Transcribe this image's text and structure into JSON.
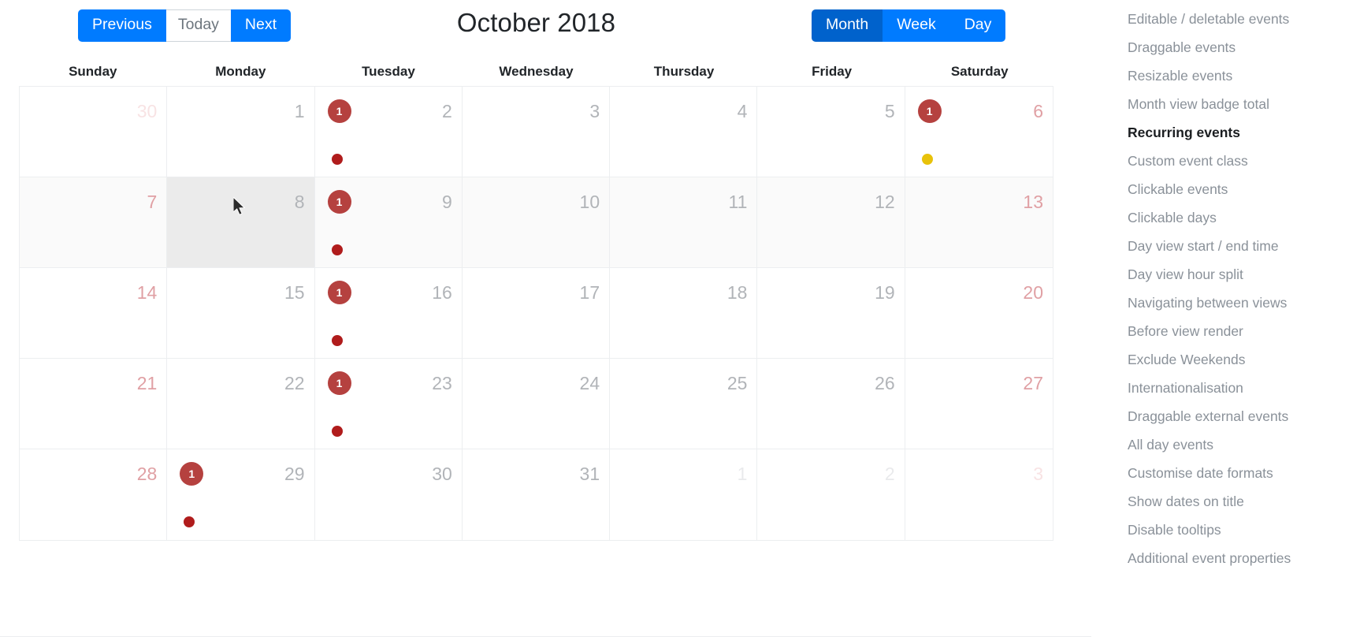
{
  "toolbar": {
    "previous_label": "Previous",
    "today_label": "Today",
    "next_label": "Next",
    "month_label": "Month",
    "week_label": "Week",
    "day_label": "Day",
    "active_view": "Month",
    "colors": {
      "primary": "#007bff",
      "primary_active": "#0062cc",
      "today_text": "#6c757d"
    }
  },
  "calendar": {
    "title": "October 2018",
    "weekdays": [
      "Sunday",
      "Monday",
      "Tuesday",
      "Wednesday",
      "Thursday",
      "Friday",
      "Saturday"
    ],
    "badge_color": "#b5413f",
    "dot_colors": {
      "red": "#b01c1c",
      "yellow": "#e8c20a"
    },
    "weeks": [
      {
        "alt": false,
        "days": [
          {
            "num": "30",
            "out": true,
            "weekend": true,
            "badge": null,
            "dot": null
          },
          {
            "num": "1",
            "out": false,
            "weekend": false,
            "badge": null,
            "dot": null
          },
          {
            "num": "2",
            "out": false,
            "weekend": false,
            "badge": "1",
            "dot": "red"
          },
          {
            "num": "3",
            "out": false,
            "weekend": false,
            "badge": null,
            "dot": null
          },
          {
            "num": "4",
            "out": false,
            "weekend": false,
            "badge": null,
            "dot": null
          },
          {
            "num": "5",
            "out": false,
            "weekend": false,
            "badge": null,
            "dot": null
          },
          {
            "num": "6",
            "out": false,
            "weekend": true,
            "badge": "1",
            "dot": "yellow"
          }
        ]
      },
      {
        "alt": true,
        "days": [
          {
            "num": "7",
            "out": false,
            "weekend": true,
            "badge": null,
            "dot": null
          },
          {
            "num": "8",
            "out": false,
            "weekend": false,
            "badge": null,
            "dot": null,
            "hovered": true
          },
          {
            "num": "9",
            "out": false,
            "weekend": false,
            "badge": "1",
            "dot": "red"
          },
          {
            "num": "10",
            "out": false,
            "weekend": false,
            "badge": null,
            "dot": null
          },
          {
            "num": "11",
            "out": false,
            "weekend": false,
            "badge": null,
            "dot": null
          },
          {
            "num": "12",
            "out": false,
            "weekend": false,
            "badge": null,
            "dot": null
          },
          {
            "num": "13",
            "out": false,
            "weekend": true,
            "badge": null,
            "dot": null
          }
        ]
      },
      {
        "alt": false,
        "days": [
          {
            "num": "14",
            "out": false,
            "weekend": true,
            "badge": null,
            "dot": null
          },
          {
            "num": "15",
            "out": false,
            "weekend": false,
            "badge": null,
            "dot": null
          },
          {
            "num": "16",
            "out": false,
            "weekend": false,
            "badge": "1",
            "dot": "red"
          },
          {
            "num": "17",
            "out": false,
            "weekend": false,
            "badge": null,
            "dot": null
          },
          {
            "num": "18",
            "out": false,
            "weekend": false,
            "badge": null,
            "dot": null
          },
          {
            "num": "19",
            "out": false,
            "weekend": false,
            "badge": null,
            "dot": null
          },
          {
            "num": "20",
            "out": false,
            "weekend": true,
            "badge": null,
            "dot": null
          }
        ]
      },
      {
        "alt": false,
        "days": [
          {
            "num": "21",
            "out": false,
            "weekend": true,
            "badge": null,
            "dot": null
          },
          {
            "num": "22",
            "out": false,
            "weekend": false,
            "badge": null,
            "dot": null
          },
          {
            "num": "23",
            "out": false,
            "weekend": false,
            "badge": "1",
            "dot": "red"
          },
          {
            "num": "24",
            "out": false,
            "weekend": false,
            "badge": null,
            "dot": null
          },
          {
            "num": "25",
            "out": false,
            "weekend": false,
            "badge": null,
            "dot": null
          },
          {
            "num": "26",
            "out": false,
            "weekend": false,
            "badge": null,
            "dot": null
          },
          {
            "num": "27",
            "out": false,
            "weekend": true,
            "badge": null,
            "dot": null
          }
        ]
      },
      {
        "alt": false,
        "days": [
          {
            "num": "28",
            "out": false,
            "weekend": true,
            "badge": null,
            "dot": null
          },
          {
            "num": "29",
            "out": false,
            "weekend": false,
            "badge": "1",
            "dot": "red"
          },
          {
            "num": "30",
            "out": false,
            "weekend": false,
            "badge": null,
            "dot": null
          },
          {
            "num": "31",
            "out": false,
            "weekend": false,
            "badge": null,
            "dot": null
          },
          {
            "num": "1",
            "out": true,
            "weekend": false,
            "badge": null,
            "dot": null
          },
          {
            "num": "2",
            "out": true,
            "weekend": false,
            "badge": null,
            "dot": null
          },
          {
            "num": "3",
            "out": true,
            "weekend": true,
            "badge": null,
            "dot": null
          }
        ]
      }
    ]
  },
  "sidebar": {
    "items": [
      {
        "label": "Editable / deletable events",
        "active": false
      },
      {
        "label": "Draggable events",
        "active": false
      },
      {
        "label": "Resizable events",
        "active": false
      },
      {
        "label": "Month view badge total",
        "active": false
      },
      {
        "label": "Recurring events",
        "active": true
      },
      {
        "label": "Custom event class",
        "active": false
      },
      {
        "label": "Clickable events",
        "active": false
      },
      {
        "label": "Clickable days",
        "active": false
      },
      {
        "label": "Day view start / end time",
        "active": false
      },
      {
        "label": "Day view hour split",
        "active": false
      },
      {
        "label": "Navigating between views",
        "active": false
      },
      {
        "label": "Before view render",
        "active": false
      },
      {
        "label": "Exclude Weekends",
        "active": false
      },
      {
        "label": "Internationalisation",
        "active": false
      },
      {
        "label": "Draggable external events",
        "active": false
      },
      {
        "label": "All day events",
        "active": false
      },
      {
        "label": "Customise date formats",
        "active": false
      },
      {
        "label": "Show dates on title",
        "active": false
      },
      {
        "label": "Disable tooltips",
        "active": false
      },
      {
        "label": "Additional event properties",
        "active": false
      }
    ]
  }
}
